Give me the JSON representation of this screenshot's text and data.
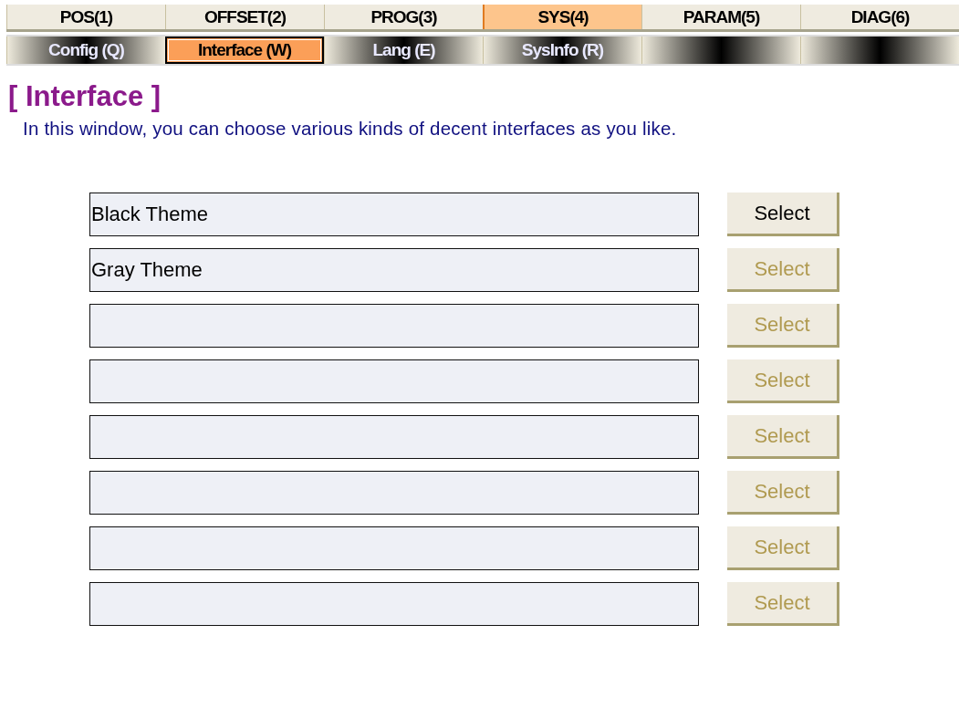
{
  "tabs": [
    {
      "label": "POS(1)",
      "selected": false
    },
    {
      "label": "OFFSET(2)",
      "selected": false
    },
    {
      "label": "PROG(3)",
      "selected": false
    },
    {
      "label": "SYS(4)",
      "selected": true
    },
    {
      "label": "PARAM(5)",
      "selected": false
    },
    {
      "label": "DIAG(6)",
      "selected": false
    }
  ],
  "subtabs": [
    {
      "label": "Config (Q)",
      "selected": false
    },
    {
      "label": "Interface (W)",
      "selected": true
    },
    {
      "label": "Lang (E)",
      "selected": false
    },
    {
      "label": "SysInfo (R)",
      "selected": false
    }
  ],
  "title": "[ Interface ]",
  "description": "In this window, you can choose various kinds of decent interfaces as you like.",
  "themes": [
    {
      "value": "Black Theme",
      "button": "Select",
      "disabled": false
    },
    {
      "value": "Gray Theme",
      "button": "Select",
      "disabled": true
    },
    {
      "button": "Select",
      "disabled": true
    },
    {
      "button": "Select",
      "disabled": true
    },
    {
      "button": "Select",
      "disabled": true
    },
    {
      "button": "Select",
      "disabled": true
    },
    {
      "button": "Select",
      "disabled": true
    },
    {
      "button": "Select",
      "disabled": true
    }
  ]
}
